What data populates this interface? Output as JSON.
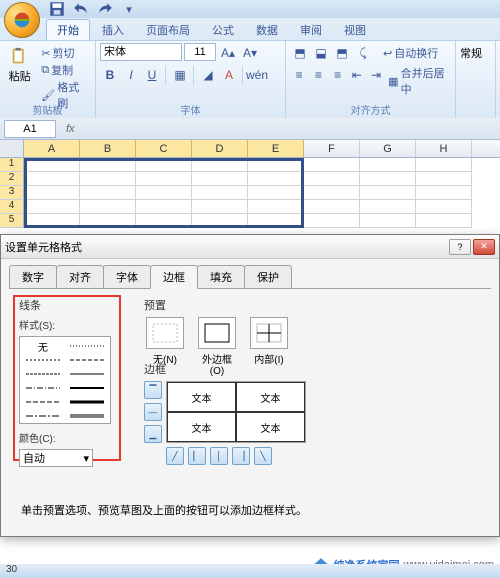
{
  "qat": {
    "save_tip": "保存",
    "undo_tip": "撤销",
    "redo_tip": "恢复"
  },
  "ribbon": {
    "tabs": [
      "开始",
      "插入",
      "页面布局",
      "公式",
      "数据",
      "审阅",
      "视图"
    ],
    "clipboard": {
      "paste": "粘贴",
      "cut": "剪切",
      "copy": "复制",
      "format_painter": "格式刷",
      "title": "剪贴板"
    },
    "font": {
      "name": "宋体",
      "size": "11",
      "title": "字体"
    },
    "align": {
      "title": "对齐方式",
      "wrap": "自动换行",
      "merge": "合并后居中"
    },
    "style_group": "常规"
  },
  "namebox": {
    "ref": "A1",
    "fx": "fx"
  },
  "columns": [
    "A",
    "B",
    "C",
    "D",
    "E",
    "F",
    "G",
    "H"
  ],
  "rows": [
    "1",
    "2",
    "3",
    "4",
    "5"
  ],
  "dialog": {
    "title": "设置单元格格式",
    "tabs": [
      "数字",
      "对齐",
      "字体",
      "边框",
      "填充",
      "保护"
    ],
    "line_section": "线条",
    "style_label": "样式(S):",
    "style_none": "无",
    "color_label": "颜色(C):",
    "color_auto": "自动",
    "preset_section": "预置",
    "presets": {
      "none": "无(N)",
      "outline": "外边框(O)",
      "inside": "内部(I)"
    },
    "border_section": "边框",
    "preview_text": "文本",
    "hint": "单击预置选项、预览草图及上面的按钮可以添加边框样式。"
  },
  "watermark": {
    "brand": "纯净系统家园",
    "url": "www.yidaimei.com"
  },
  "footer": "30"
}
